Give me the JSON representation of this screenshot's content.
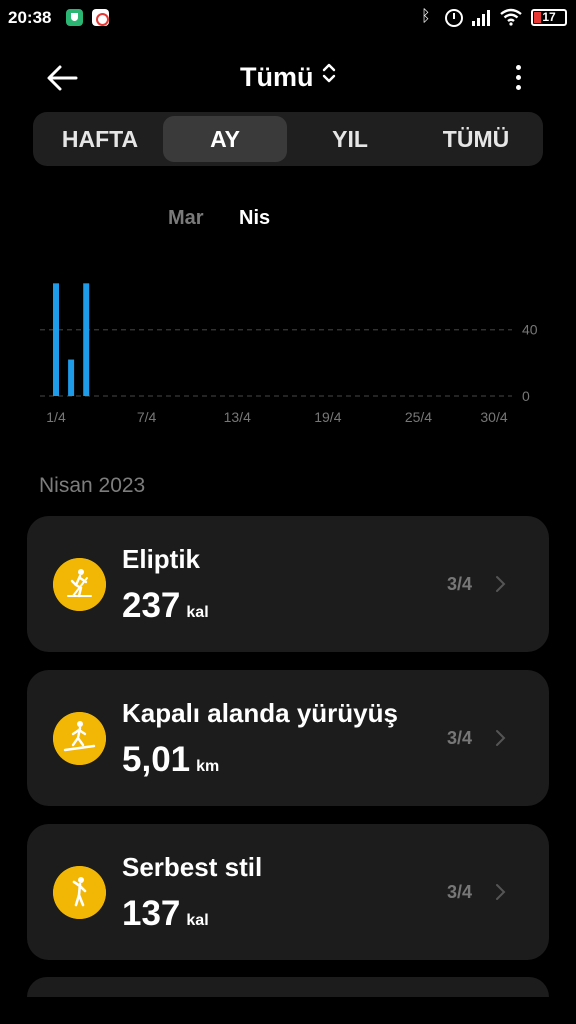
{
  "status_bar": {
    "time": "20:38",
    "battery": "17",
    "icons": [
      "shield-notification-icon",
      "record-notification-icon",
      "bluetooth-icon",
      "alarm-icon",
      "signal-icon",
      "wifi-icon",
      "battery-icon"
    ]
  },
  "header": {
    "title": "Tümü",
    "back_icon": "arrow-left-icon",
    "filter_icon": "chevron-up-down-icon",
    "more_icon": "more-vertical-icon"
  },
  "tabs": [
    {
      "label": "HAFTA",
      "active": false
    },
    {
      "label": "AY",
      "active": true
    },
    {
      "label": "YIL",
      "active": false
    },
    {
      "label": "TÜMÜ",
      "active": false
    }
  ],
  "months": {
    "previous": "Mar",
    "current": "Nis"
  },
  "chart_data": {
    "type": "bar",
    "x": [
      "1/4",
      "2/4",
      "3/4"
    ],
    "values": [
      68,
      22,
      68
    ],
    "x_tick_labels": [
      "1/4",
      "7/4",
      "13/4",
      "19/4",
      "25/4",
      "30/4"
    ],
    "y_tick_labels": [
      "40",
      "0"
    ],
    "ylim": [
      0,
      70
    ],
    "grid": true,
    "color": "#1e9be9"
  },
  "section": {
    "title": "Nisan 2023"
  },
  "activities": [
    {
      "name": "Eliptik",
      "value": "237",
      "unit": "kal",
      "date": "3/4",
      "icon": "elliptical-trainer-icon"
    },
    {
      "name": "Kapalı alanda yürüyüş",
      "value": "5,01",
      "unit": "km",
      "date": "3/4",
      "icon": "indoor-walking-icon"
    },
    {
      "name": "Serbest stil",
      "value": "137",
      "unit": "kal",
      "date": "3/4",
      "icon": "freestyle-workout-icon"
    }
  ],
  "colors": {
    "accent": "#f2b705",
    "bar": "#1e9be9",
    "card": "#1c1c1c",
    "background": "#000000"
  }
}
